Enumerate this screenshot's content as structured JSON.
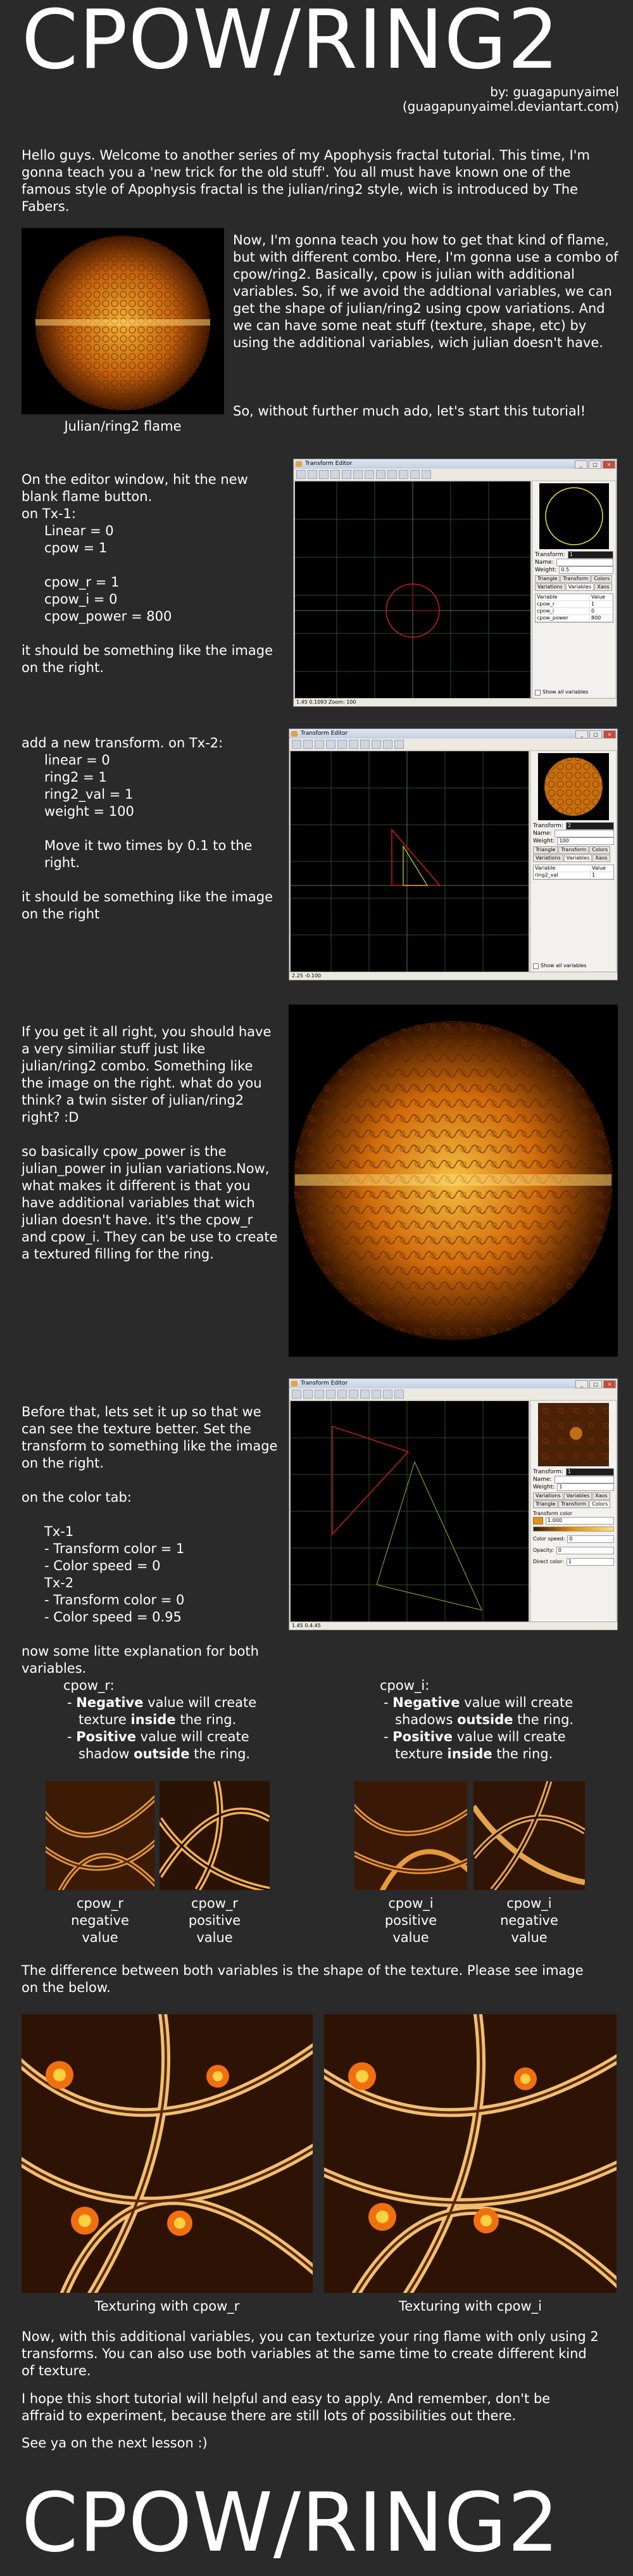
{
  "title": "CPOW/RING2",
  "footer_title": "CPOW/RING2",
  "byline": {
    "line1": "by: guagapunyaimel",
    "line2": "(guagapunyaimel.deviantart.com)"
  },
  "intro": "Hello guys. Welcome to another series of my Apophysis fractal tutorial. This time, I'm gonna teach you a 'new trick for the old stuff'. You all must have known one of the famous style of Apophysis fractal is the julian/ring2 style, wich is introduced by The Fabers.",
  "section1": {
    "image_caption": "Julian/ring2 flame",
    "text1": "Now, I'm gonna teach you how to get that kind of flame, but with different combo. Here, I'm gonna use a combo of cpow/ring2. Basically, cpow is julian with additional variables. So, if we avoid the addtional variables, we can get the shape of julian/ring2 using cpow variations. And we can have some neat stuff (texture, shape, etc) by using the additional variables, wich julian doesn't have.",
    "text2": "So, without further much ado, let's start this tutorial!"
  },
  "step1": {
    "lead": "On the editor window, hit the new\nblank flame button.",
    "tx": "on Tx-1:",
    "params": [
      "Linear = 0",
      "cpow = 1",
      "",
      "cpow_r = 1",
      "cpow_i = 0",
      "cpow_power = 800"
    ],
    "after": "it should be something like the image\non the right."
  },
  "step2": {
    "lead": "add a new transform. on Tx-2:",
    "params": [
      "linear = 0",
      "ring2 = 1",
      "ring2_val = 1",
      "weight = 100"
    ],
    "move": "Move it two times by 0.1 to the\nright.",
    "after": "it should be something like the image\non the right"
  },
  "step3": {
    "text1": "If you get it all right, you should have\na very similiar stuff just like\njulian/ring2 combo. Something like\nthe image on the right. what do you\nthink? a twin sister of julian/ring2\nright? :D",
    "text2": "so basically cpow_power is the\njulian_power in julian variations.Now,\nwhat makes it different is that you\nhave additional variables that wich\njulian doesn't have. it's the cpow_r\nand cpow_i. They can be use to create\na textured filling for the ring."
  },
  "step4": {
    "text1": "Before that, lets set it up so that we\ncan see the texture better. Set the\ntransform to something like the image\non the right.",
    "color_tab": "on the color tab:",
    "color_params": [
      "Tx-1",
      "- Transform color = 1",
      "- Color speed = 0",
      "Tx-2",
      "- Transform color = 0",
      "- Color speed = 0.95"
    ],
    "explain": "now some litte explanation for both\nvariables."
  },
  "cpow_r": {
    "heading": "cpow_r:",
    "neg_word": "Negative",
    "neg_pre": "- ",
    "neg_mid": " value will create",
    "neg_l2_pre": "texture ",
    "neg_l2_bold": "inside",
    "neg_l2_post": " the ring.",
    "pos_word": "Positive",
    "pos_pre": "- ",
    "pos_mid": " value will create",
    "pos_l2_pre": "shadow ",
    "pos_l2_bold": "outside",
    "pos_l2_post": " the ring.",
    "thumb1_caption": "cpow_r\nnegative\nvalue",
    "thumb2_caption": "cpow_r\npositive\nvalue"
  },
  "cpow_i": {
    "heading": "cpow_i:",
    "neg_word": "Negative",
    "neg_pre": "- ",
    "neg_mid": " value will create",
    "neg_l2_pre": "shadows ",
    "neg_l2_bold": "outside",
    "neg_l2_post": " the ring.",
    "pos_word": "Positive",
    "pos_pre": "- ",
    "pos_mid": " value will create",
    "pos_l2_pre": "texture ",
    "pos_l2_bold": "inside",
    "pos_l2_post": " the ring.",
    "thumb1_caption": "cpow_i\npositive\nvalue",
    "thumb2_caption": "cpow_i\nnegative\nvalue"
  },
  "difference": "The difference between both variables is the shape of the texture. Please see image\non the below.",
  "big_captions": [
    "Texturing with cpow_r",
    "Texturing with cpow_i"
  ],
  "closing1": "Now, with this additional variables, you can texturize your ring flame with only using 2\ntransforms. You can also use both variables at the same time to create different kind\nof texture.",
  "closing2": "I hope this short tutorial will helpful and easy to apply. And remember, don't be\naffraid to experiment, because there are still lots of possibilities out there.",
  "closing3": "See ya on the next lesson :)",
  "editor": {
    "window_title": "Transform Editor",
    "transform_label": "Transform:",
    "name_label": "Name:",
    "weight_label": "Weight:",
    "tabs": [
      "Triangle",
      "Transform",
      "Colors",
      "Variations",
      "Variables",
      "Xaos"
    ],
    "variable_header": "Variable",
    "value_header": "Value",
    "show_all": "Show all variables",
    "ed1": {
      "weight": "0.5",
      "vars": [
        [
          "cpow_r",
          "1"
        ],
        [
          "cpow_i",
          "0"
        ],
        [
          "cpow_power",
          "800"
        ]
      ],
      "status": "1.45    0.1093    Zoom: 100"
    },
    "ed2": {
      "weight": "100",
      "vars": [
        [
          "ring2_val",
          "1"
        ]
      ],
      "status": "2.25    -0.100"
    },
    "ed3": {
      "weight": "1",
      "transform_color_label": "Transform color",
      "transform_color": "1.000",
      "color_speed_label": "Color speed:",
      "color_speed": "0",
      "opacity_label": "Opacity:",
      "opacity": "0",
      "direct_color_label": "Direct color:",
      "direct_color": "1",
      "status": "1.45    0.4.45"
    }
  },
  "colors": {
    "bg": "#2a2a2a",
    "text": "#ffffff",
    "flame_orange": "#e8900c",
    "flame_dark": "#3a1a00",
    "axis_red": "#c81e1e",
    "triangle_yellow": "#d8d232"
  }
}
